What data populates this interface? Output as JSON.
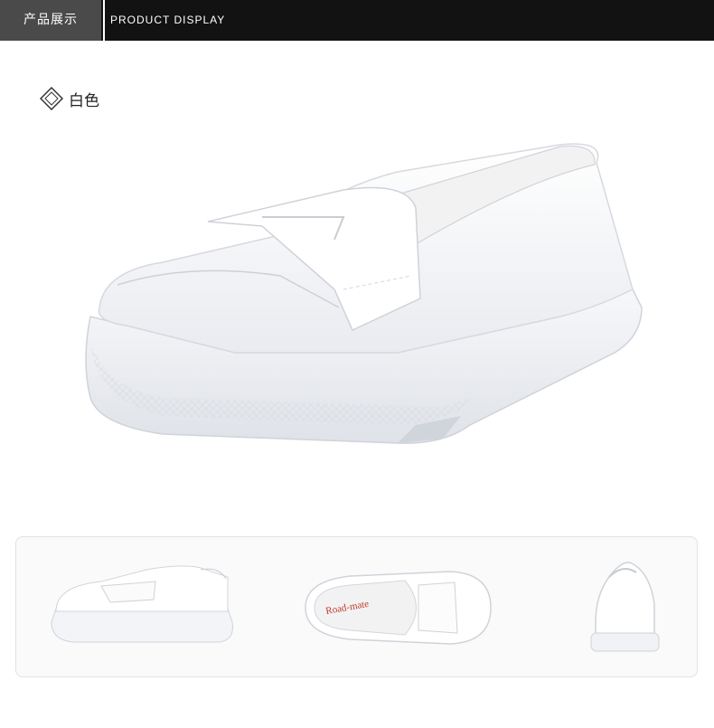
{
  "header": {
    "tab_label": "产品展示",
    "subtitle": "PRODUCT DISPLAY"
  },
  "color_option": {
    "label": "白色",
    "icon": "diamond-icon"
  },
  "thumb_brand": "Road-mate",
  "colors": {
    "header_bg": "#121212",
    "tab_bg": "#4a4a4a",
    "shoe": "#ffffff"
  }
}
